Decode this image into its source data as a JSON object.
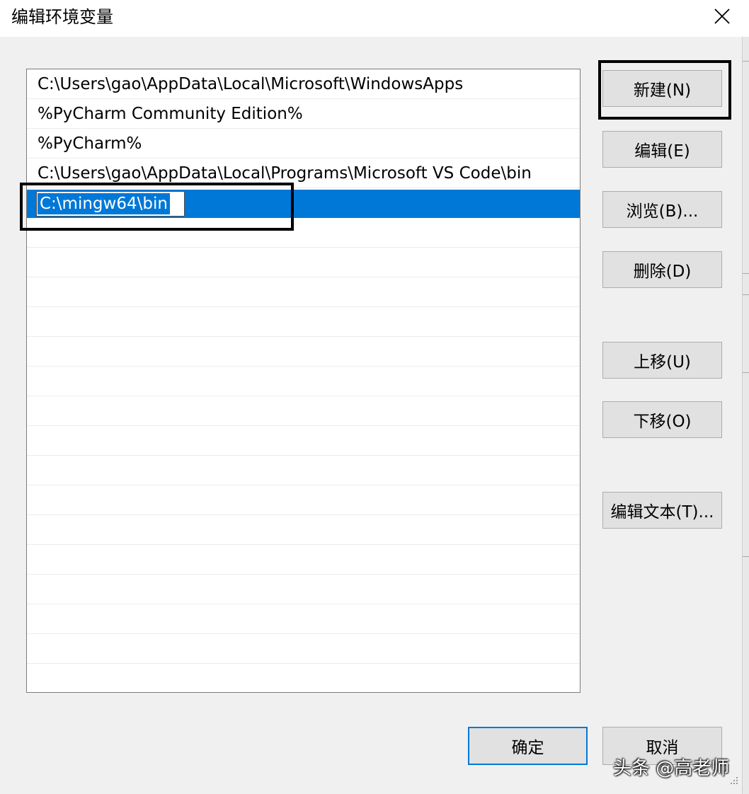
{
  "window": {
    "title": "编辑环境变量",
    "close_icon": "close-icon"
  },
  "list": {
    "items": [
      "C:\\Users\\gao\\AppData\\Local\\Microsoft\\WindowsApps",
      "%PyCharm Community Edition%",
      "%PyCharm%",
      "C:\\Users\\gao\\AppData\\Local\\Programs\\Microsoft VS Code\\bin"
    ],
    "editing_value": "C:\\mingw64\\bin",
    "selection_color": "#0078d7"
  },
  "buttons": {
    "new": "新建(N)",
    "edit": "编辑(E)",
    "browse": "浏览(B)...",
    "delete": "删除(D)",
    "move_up": "上移(U)",
    "move_down": "下移(O)",
    "edit_text": "编辑文本(T)...",
    "ok": "确定",
    "cancel": "取消"
  },
  "watermark": "头条 @高老师"
}
